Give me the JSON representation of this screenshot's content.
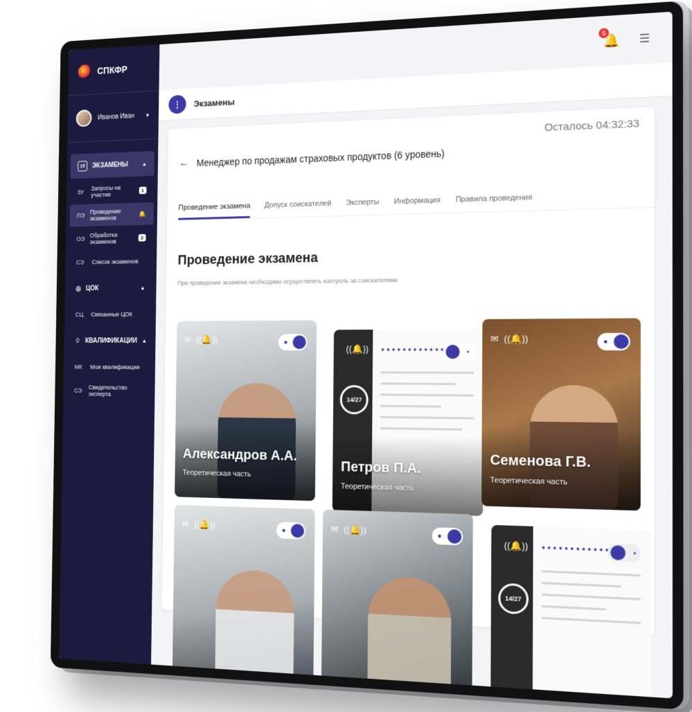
{
  "app": {
    "brand": "СПКФР"
  },
  "user": {
    "name": "Иванов Иван"
  },
  "topbar": {
    "notifications_count": "5"
  },
  "page": {
    "title": "Экзамены"
  },
  "sidebar": {
    "sections": [
      {
        "label": "ЭКЗАМЕНЫ",
        "icon": "calendar-icon",
        "icon_text": "15"
      },
      {
        "label": "ЦОК",
        "icon": "location-pin-icon"
      },
      {
        "label": "КВАЛИФИКАЦИИ",
        "icon": "diploma-icon"
      }
    ],
    "items": [
      {
        "abbr": "ЗУ",
        "label": "Запросы на участие",
        "badge": "1"
      },
      {
        "abbr": "ПЭ",
        "label": "Проведение экзаменов"
      },
      {
        "abbr": "ОЭ",
        "label": "Обработка экзаменов",
        "badge": "3"
      },
      {
        "abbr": "СЭ",
        "label": "Список экзаменов"
      },
      {
        "abbr": "СЦ",
        "label": "Связанные ЦОК"
      },
      {
        "abbr": "МК",
        "label": "Мои квалификации"
      },
      {
        "abbr": "СЭ",
        "label": "Свидетельство эксперта"
      }
    ]
  },
  "exam": {
    "timer": "Осталось 04:32:33",
    "title": "Менеджер по продажам страховых продуктов (6 уровень)",
    "tabs": [
      "Проведение экзамена",
      "Допуск соискателей",
      "Эксперты",
      "Информация",
      "Правила проведения"
    ],
    "section_title": "Проведение экзамена",
    "section_subtitle": "При проведении экзамена необходимо осуществлять контроль за соискателями"
  },
  "candidates": [
    {
      "name": "Александров А.А.",
      "part": "Теоретическая часть"
    },
    {
      "name": "Петров П.А.",
      "part": "Теоретическая часть",
      "progress": "14/27"
    },
    {
      "name": "Семенова Г.В.",
      "part": "Теоретическая часть"
    }
  ],
  "tile_bottom": [
    {
      "progress": "14/27"
    }
  ],
  "colors": {
    "sidebar": "#1c1a3f",
    "accent": "#3d3aa5",
    "badge": "#e53935"
  }
}
